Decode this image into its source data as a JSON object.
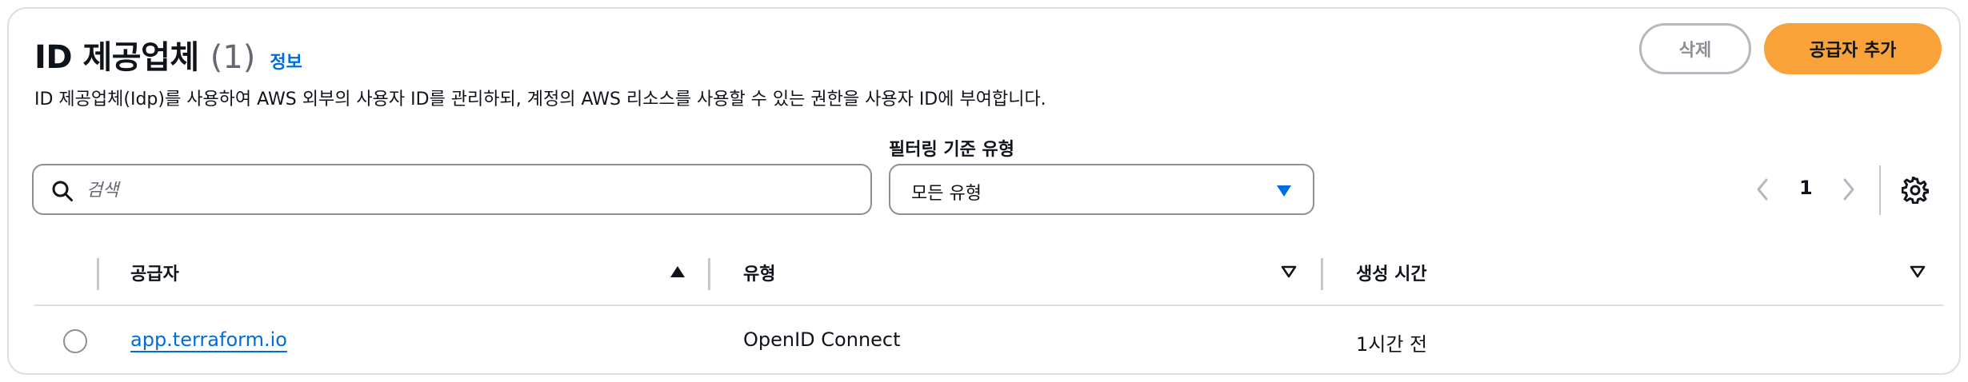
{
  "header": {
    "title": "ID 제공업체",
    "count": "(1)",
    "info_link": "정보",
    "description": "ID 제공업체(Idp)를 사용하여 AWS 외부의 사용자 ID를 관리하되, 계정의 AWS 리소스를 사용할 수 있는 권한을 사용자 ID에 부여합니다."
  },
  "actions": {
    "delete_label": "삭제",
    "delete_enabled": false,
    "add_label": "공급자 추가",
    "accent_color": "#f9a23a"
  },
  "search": {
    "placeholder": "검색",
    "value": "",
    "icon": "search-icon"
  },
  "filter": {
    "label": "필터링 기준 유형",
    "selected": "모든 유형",
    "caret_color": "#006ce0"
  },
  "pagination": {
    "current_page": "1",
    "prev_icon": "chevron-left-icon",
    "next_icon": "chevron-right-icon",
    "settings_icon": "gear-icon"
  },
  "table": {
    "columns": [
      {
        "label": "공급자",
        "sort": "ascending"
      },
      {
        "label": "유형",
        "sort": "none"
      },
      {
        "label": "생성 시간",
        "sort": "none"
      }
    ],
    "rows": [
      {
        "provider": "app.terraform.io",
        "type": "OpenID Connect",
        "created": "1시간 전",
        "selected": false
      }
    ]
  }
}
